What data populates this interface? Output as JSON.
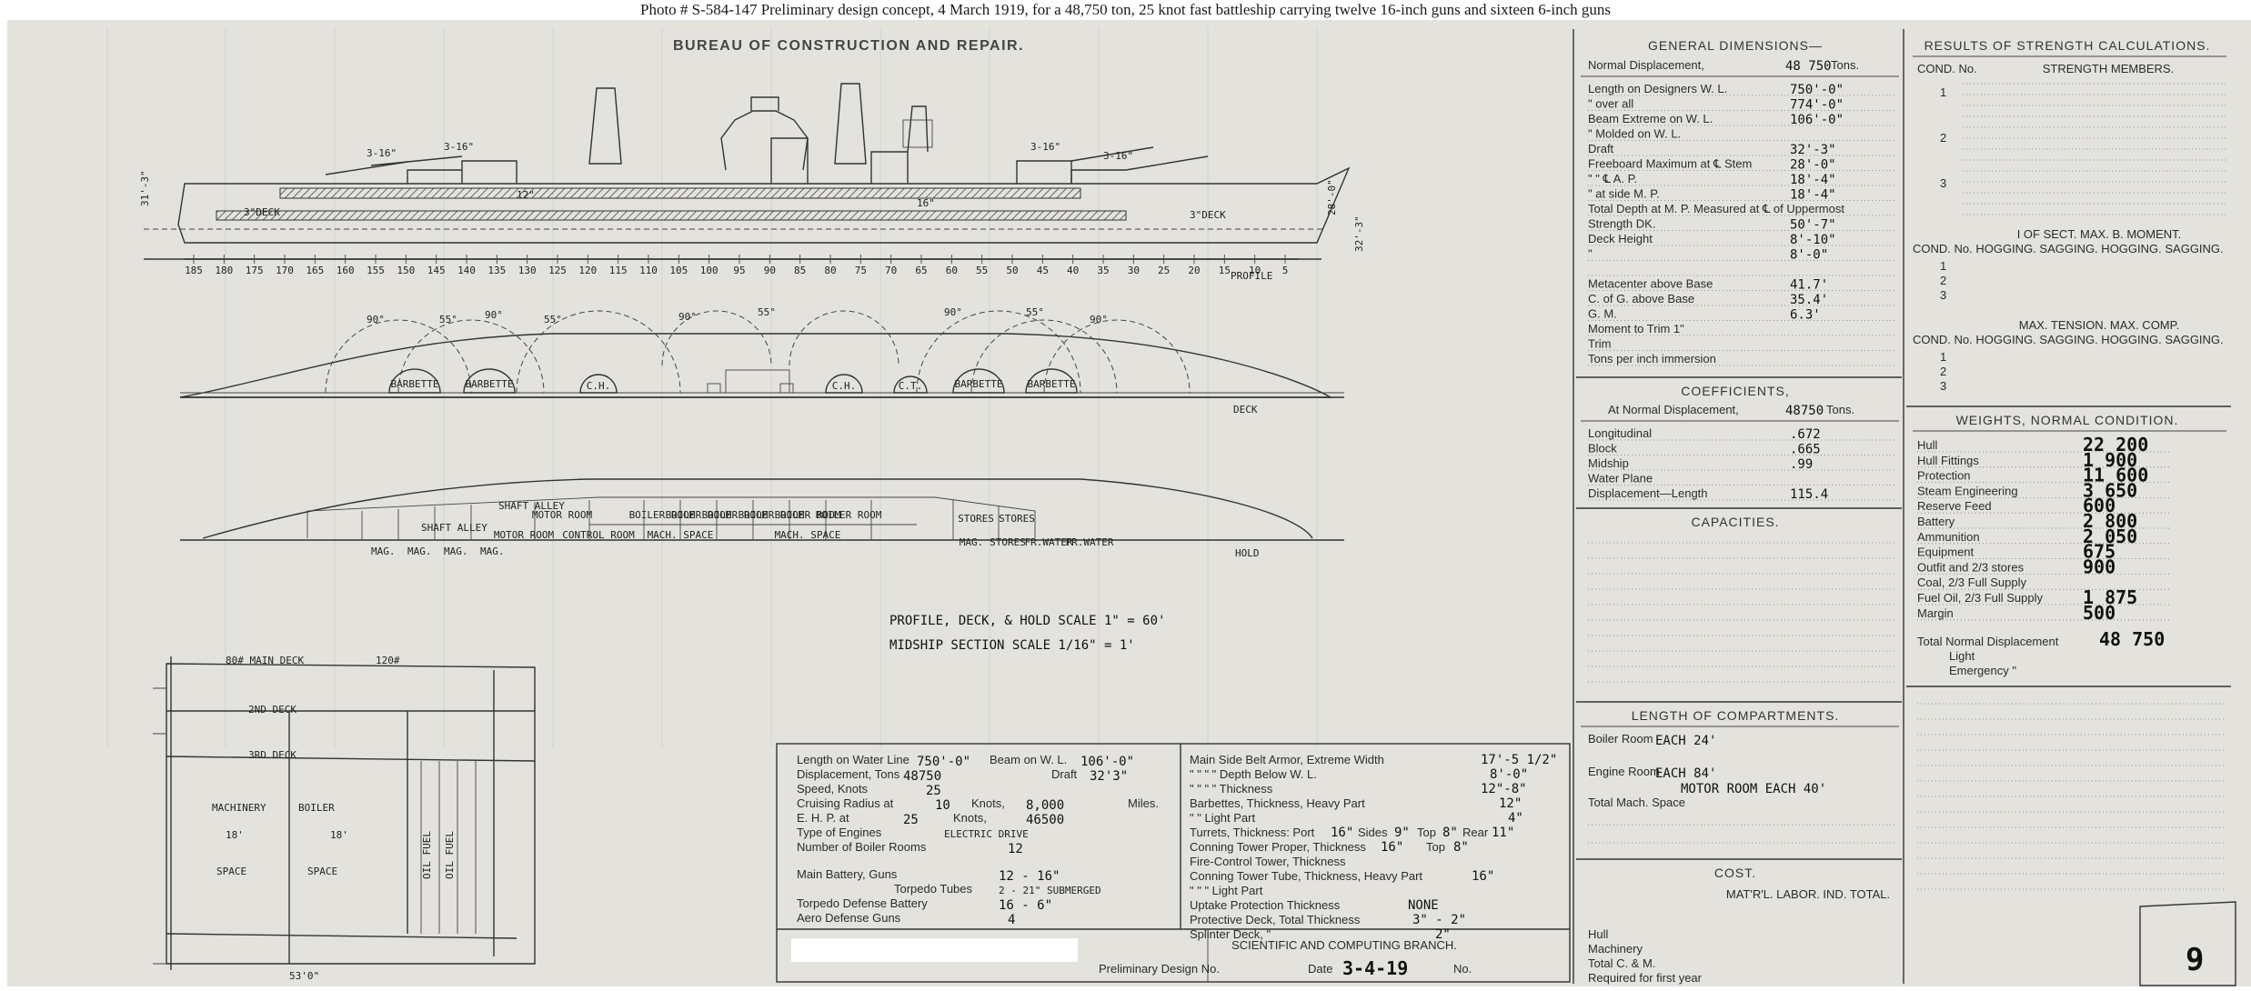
{
  "caption": "Photo # S-584-147 Preliminary design concept, 4 March 1919, for a 48,750 ton, 25 knot fast battleship carrying twelve 16-inch guns and sixteen 6-inch guns",
  "drawing": {
    "bureau_title": "BUREAU OF CONSTRUCTION AND REPAIR.",
    "profile_label": "PROFILE",
    "deck_label": "DECK",
    "hold_label": "HOLD",
    "scale_note_1": "PROFILE, DECK, & HOLD   SCALE 1\" = 60'",
    "scale_note_2": "MIDSHIP SECTION   SCALE 1/16\" = 1'",
    "frame_numbers": [
      "185",
      "180",
      "175",
      "170",
      "165",
      "160",
      "155",
      "150",
      "145",
      "140",
      "135",
      "130",
      "125",
      "120",
      "115",
      "110",
      "105",
      "100",
      "95",
      "90",
      "85",
      "80",
      "75",
      "70",
      "65",
      "60",
      "55",
      "50",
      "45",
      "40",
      "35",
      "30",
      "25",
      "20",
      "15",
      "10",
      "5"
    ],
    "deck_plan_labels": [
      "BARBETTE",
      "BARBETTE",
      "C.H.",
      "C.H.",
      "C.T.",
      "BARBETTE",
      "BARBETTE"
    ],
    "turret_angles": [
      "90°",
      "55°",
      "90°",
      "55°",
      "90°",
      "55°",
      "90°",
      "55°",
      "90°"
    ],
    "hold_labels": [
      "SHAFT ALLEY",
      "SHAFT ALLEY",
      "MAG.",
      "MAG.",
      "MAG.",
      "MAG.",
      "MOTOR ROOM",
      "MOTOR ROOM",
      "CONTROL ROOM",
      "BOILER ROOM",
      "BOILER ROOM",
      "BOILER ROOM",
      "BOILER ROOM",
      "BOILER ROOM",
      "BOILER ROOM",
      "MACH. SPACE",
      "MACH. SPACE",
      "STORES",
      "STORES",
      "MAG.",
      "STORES",
      "FR.WATER",
      "FR.WATER"
    ],
    "midship_section": {
      "main_deck": "80# MAIN DECK",
      "main_deck_2": "120#",
      "second_deck": "2ND DECK",
      "third_deck": "3RD DECK",
      "machinery": "MACHINERY",
      "boiler": "BOILER",
      "space_1": "SPACE",
      "space_2": "SPACE",
      "width_1": "18'",
      "width_2": "18'",
      "oil_fuel": "OIL FUEL",
      "overall_width": "53'0\""
    },
    "sheet_number": "9"
  },
  "general_dimensions": {
    "heading": "GENERAL DIMENSIONS—",
    "normal_displacement_label": "Normal Displacement,",
    "normal_displacement_value": "48 750",
    "normal_displacement_unit": "Tons.",
    "rows": [
      {
        "label": "Length on Designers W. L.",
        "value": "750'-0\""
      },
      {
        "label": "\"   over all",
        "value": "774'-0\""
      },
      {
        "label": "Beam Extreme on W. L.",
        "value": "106'-0\""
      },
      {
        "label": "\"   Molded on W. L.",
        "value": ""
      },
      {
        "label": "Draft",
        "value": "32'-3\""
      },
      {
        "label": "Freeboard Maximum at ℄ Stem",
        "value": "28'-0\""
      },
      {
        "label": "\"   \"   ℄ A. P.",
        "value": "18'-4\""
      },
      {
        "label": "\"   at side   M. P.",
        "value": "18'-4\""
      },
      {
        "label": "Total Depth at M. P. Measured at ℄ of Uppermost",
        "value": ""
      },
      {
        "label": "Strength DK.",
        "value": "50'-7\""
      },
      {
        "label": "Deck Height",
        "value": "8'-10\""
      },
      {
        "label": "\"",
        "value": "8'-0\""
      },
      {
        "label": "",
        "value": ""
      },
      {
        "label": "Metacenter above Base",
        "value": "41.7'"
      },
      {
        "label": "C. of G. above Base",
        "value": "35.4'"
      },
      {
        "label": "G. M.",
        "value": "6.3'"
      },
      {
        "label": "Moment to Trim 1\"",
        "value": ""
      },
      {
        "label": "Trim",
        "value": ""
      },
      {
        "label": "Tons per inch immersion",
        "value": ""
      }
    ]
  },
  "coefficients": {
    "heading": "COEFFICIENTS,",
    "at_label": "At Normal Displacement,",
    "at_value": "48750",
    "at_unit": "Tons.",
    "rows": [
      {
        "label": "Longitudinal",
        "value": ".672"
      },
      {
        "label": "Block",
        "value": ".665"
      },
      {
        "label": "Midship",
        "value": ".99"
      },
      {
        "label": "Water Plane",
        "value": ""
      },
      {
        "label": "Displacement—Length",
        "value": "115.4"
      }
    ]
  },
  "capacities": {
    "heading": "CAPACITIES."
  },
  "length_of_compartments": {
    "heading": "LENGTH OF COMPARTMENTS.",
    "boiler_room_label": "Boiler Room",
    "boiler_room_value": "EACH 24'",
    "engine_room_label": "Engine Room",
    "engine_room_value": "EACH 84'",
    "motor_room_value": "MOTOR ROOM   EACH 40'",
    "total_label": "Total Mach. Space"
  },
  "cost": {
    "heading": "COST.",
    "columns": "MAT'R'L.  LABOR.  IND.  TOTAL.",
    "rows": [
      "Hull",
      "Machinery",
      "Total C. & M.",
      "Required for first year"
    ]
  },
  "strength": {
    "heading": "RESULTS OF STRENGTH CALCULATIONS.",
    "col1": "COND. No.",
    "col2": "STRENGTH MEMBERS.",
    "conds": [
      "1",
      "2",
      "3"
    ],
    "moment_heading": "I OF SECT.     MAX. B. MOMENT.",
    "moment_cols": "COND. No. HOGGING. SAGGING. HOGGING. SAGGING.",
    "tension_heading": "MAX. TENSION.     MAX. COMP.",
    "tension_cols": "COND. No. HOGGING. SAGGING. HOGGING. SAGGING."
  },
  "weights": {
    "heading": "WEIGHTS, NORMAL CONDITION.",
    "rows": [
      {
        "label": "Hull",
        "value": "22 200"
      },
      {
        "label": "Hull Fittings",
        "value": "1 900"
      },
      {
        "label": "Protection",
        "value": "11 600"
      },
      {
        "label": "Steam Engineering",
        "value": "3 650"
      },
      {
        "label": "Reserve Feed",
        "value": "600"
      },
      {
        "label": "Battery",
        "value": "2 800"
      },
      {
        "label": "Ammunition",
        "value": "2 050"
      },
      {
        "label": "Equipment",
        "value": "675"
      },
      {
        "label": "Outfit and 2/3 stores",
        "value": "900"
      },
      {
        "label": "Coal, 2/3 Full Supply",
        "value": ""
      },
      {
        "label": "Fuel Oil, 2/3 Full Supply",
        "value": "1 875"
      },
      {
        "label": "Margin",
        "value": "500"
      }
    ],
    "total_label": "Total Normal Displacement",
    "total_value": "48 750",
    "light_label": "Light",
    "emergency_label": "Emergency  \""
  },
  "bottom_left_table": {
    "rows": [
      {
        "label": "Length on Water Line",
        "value": "750'-0\"",
        "label2": "Beam on W. L.",
        "value2": "106'-0\""
      },
      {
        "label": "Displacement, Tons",
        "value": "48750",
        "label2": "Draft",
        "value2": "32'3\""
      },
      {
        "label": "Speed, Knots",
        "value": "25"
      },
      {
        "label": "Cruising Radius at",
        "value": "10",
        "label2": "Knots,",
        "value2": "8,000",
        "label3": "Miles."
      },
      {
        "label": "E. H. P. at",
        "value": "25",
        "label2": "Knots,",
        "value2": "46500"
      },
      {
        "label": "Type of Engines",
        "value": "ELECTRIC DRIVE"
      },
      {
        "label": "Number of Boiler Rooms",
        "value": "12"
      },
      {
        "label": "Main Battery, Guns",
        "value": "12 - 16\""
      },
      {
        "label": "Torpedo Tubes",
        "value": "2 - 21\" SUBMERGED"
      },
      {
        "label": "Torpedo Defense Battery",
        "value": "16 - 6\""
      },
      {
        "label": "Aero Defense Guns",
        "value": "4"
      }
    ]
  },
  "bottom_right_table": {
    "rows": [
      {
        "label": "Main Side Belt Armor, Extreme Width",
        "value": "17'-5 1/2\""
      },
      {
        "label": "\"   \"   \"   \"   Depth Below W. L.",
        "value": "8'-0\""
      },
      {
        "label": "\"   \"   \"   \"   Thickness",
        "value": "12\"-8\""
      },
      {
        "label": "Barbettes, Thickness, Heavy Part",
        "value": "12\""
      },
      {
        "label": "\"   \"   Light Part",
        "value": "4\""
      },
      {
        "label": "Turrets, Thickness: Port",
        "value": "16\"",
        "label2": "Sides",
        "value2": "9\"",
        "label3": "Top",
        "value3": "8\"",
        "label4": "Rear",
        "value4": "11\""
      },
      {
        "label": "Conning Tower Proper, Thickness",
        "value": "16\"",
        "label2": "Top",
        "value2": "8\""
      },
      {
        "label": "Fire-Control Tower, Thickness",
        "value": ""
      },
      {
        "label": "Conning Tower Tube, Thickness, Heavy Part",
        "value": "16\""
      },
      {
        "label": "\"   \"   \"   Light Part",
        "value": ""
      },
      {
        "label": "Uptake Protection Thickness",
        "value": "NONE"
      },
      {
        "label": "Protective Deck, Total Thickness",
        "value": "3\" - 2\""
      },
      {
        "label": "Splinter Deck,   \"",
        "value": "2\""
      }
    ]
  },
  "title_block": {
    "branch": "SCIENTIFIC AND COMPUTING BRANCH.",
    "design_label": "Preliminary Design No.",
    "date_label": "Date",
    "date_value": "3-4-19",
    "no_label": "No."
  }
}
